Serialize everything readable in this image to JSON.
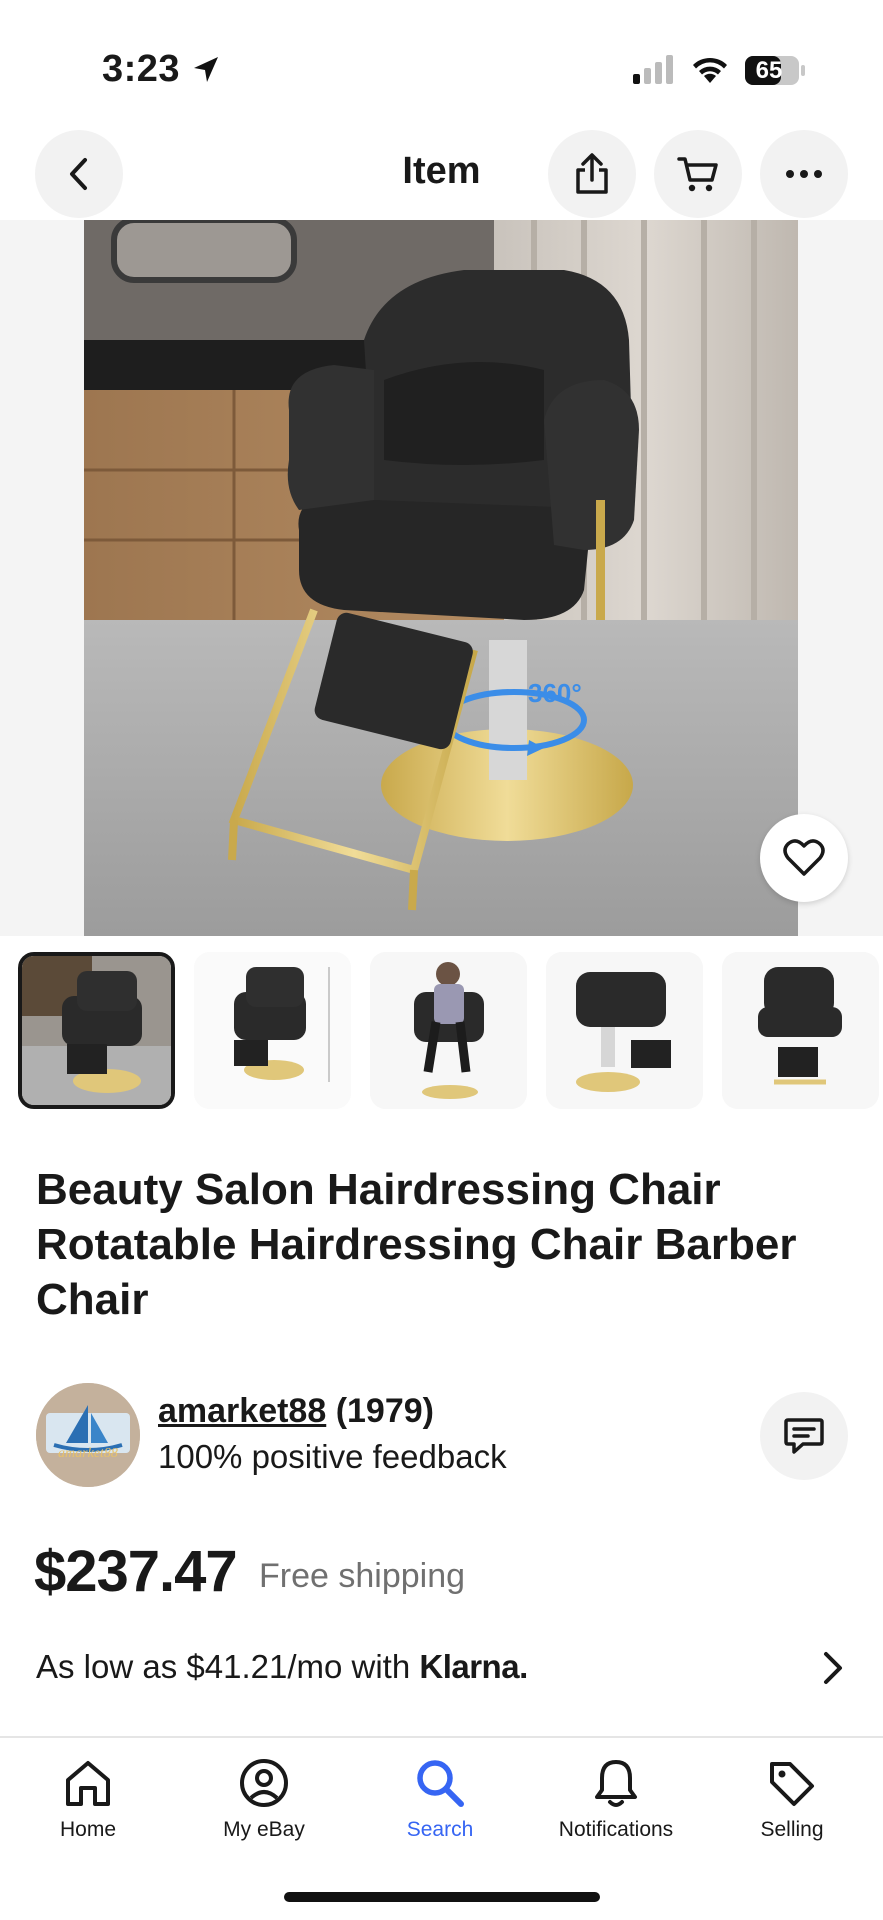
{
  "status_bar": {
    "time": "3:23",
    "battery": "65"
  },
  "nav": {
    "title": "Item",
    "icons": [
      "back-chevron-icon",
      "share-icon",
      "cart-icon",
      "more-icon"
    ]
  },
  "gallery": {
    "hero_badge": "360°",
    "thumbnail_count": 5,
    "selected_index": 0
  },
  "listing": {
    "title": "Beauty Salon Hairdressing Chair Rotatable Hairdressing Chair Barber Chair"
  },
  "seller": {
    "username": "amarket88",
    "score": "(1979)",
    "feedback": "100% positive feedback",
    "avatar_text": "amarket88"
  },
  "price": {
    "amount": "$237.47",
    "shipping": "Free shipping"
  },
  "financing": {
    "prefix": "As low as $41.21/mo with",
    "brand": "Klarna."
  },
  "tabbar": {
    "items": [
      {
        "label": "Home",
        "icon": "home-icon"
      },
      {
        "label": "My eBay",
        "icon": "user-icon"
      },
      {
        "label": "Search",
        "icon": "search-icon"
      },
      {
        "label": "Notifications",
        "icon": "bell-icon"
      },
      {
        "label": "Selling",
        "icon": "tag-icon"
      }
    ],
    "active": "Search"
  },
  "colors": {
    "accent": "#3665f3",
    "text": "#191919",
    "muted": "#707070",
    "gold": "#d9bf6a",
    "rotate_blue": "#3b8de8"
  }
}
